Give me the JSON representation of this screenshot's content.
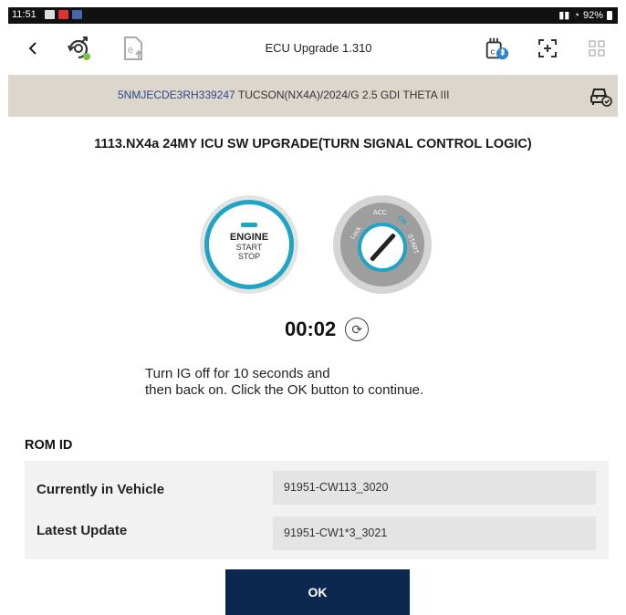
{
  "status_bar": {
    "time": "11:51",
    "battery": "92%",
    "icons": [
      "gallery-icon",
      "news-icon",
      "app-icon"
    ]
  },
  "toolbar": {
    "title": "ECU Upgrade 1.310",
    "back_icon": "chevron-left-icon",
    "icons": [
      "ota-update-icon",
      "e-document-icon",
      "bluetooth-vci-icon",
      "fullscreen-icon",
      "grid-menu-icon"
    ]
  },
  "vehicle": {
    "vin": "5NMJECDE3RH339247",
    "description": "TUCSON(NX4A)/2024/G 2.5 GDI THETA III"
  },
  "heading": "1113.NX4a 24MY ICU SW UPGRADE(TURN SIGNAL CONTROL LOGIC)",
  "engine_button": {
    "line1": "ENGINE",
    "line2": "START",
    "line3": "STOP"
  },
  "ignition_key": {
    "positions": [
      "Lock",
      "ACC",
      "ON",
      "START"
    ]
  },
  "timer": "00:02",
  "instruction": {
    "line1": "Turn IG off for 10 seconds and",
    "line2": "then back on. Click the OK button to continue."
  },
  "rom_id": {
    "title": "ROM ID",
    "rows": [
      {
        "label": "Currently in Vehicle",
        "value": "91951-CW113_3020"
      },
      {
        "label": "Latest Update",
        "value": "91951-CW1*3_3021"
      }
    ]
  },
  "ok_button": "OK",
  "colors": {
    "accent": "#1ea4c4",
    "primary_button": "#0c2750",
    "vin_bar": "#ddd6cd",
    "vin_text": "#2a4a8a"
  }
}
